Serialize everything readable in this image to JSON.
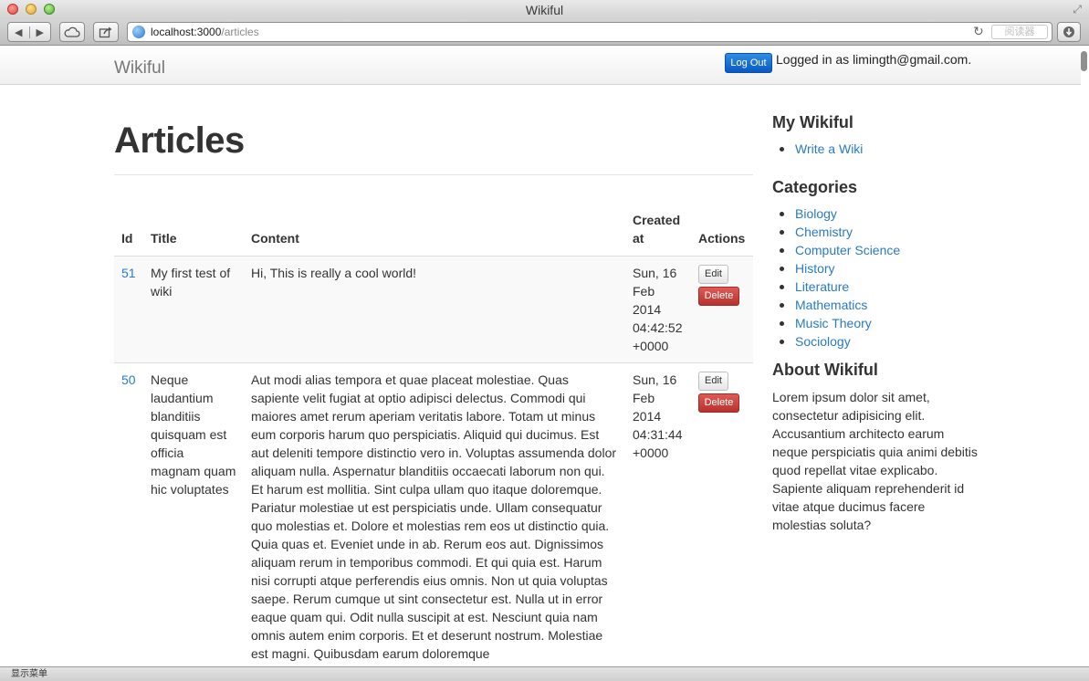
{
  "window": {
    "title": "Wikiful"
  },
  "toolbar": {
    "url_host": "localhost:3000",
    "url_path": "/articles",
    "reader_label": "阅读器"
  },
  "status_bar": {
    "text": "显示菜单"
  },
  "navbar": {
    "brand": "Wikiful",
    "logout_label": "Log Out",
    "login_text": "Logged in as limingth@gmail.com."
  },
  "main": {
    "title": "Articles",
    "table": {
      "headers": {
        "id": "Id",
        "title": "Title",
        "content": "Content",
        "created_at": "Created at",
        "actions": "Actions"
      },
      "edit_label": "Edit",
      "delete_label": "Delete",
      "rows": [
        {
          "id": "51",
          "title": "My first test of wiki",
          "content": "Hi, This is really a cool world!",
          "created_at": "Sun, 16 Feb 2014 04:42:52 +0000"
        },
        {
          "id": "50",
          "title": "Neque laudantium blanditiis quisquam est officia magnam quam hic voluptates",
          "content": "Aut modi alias tempora et quae placeat molestiae. Quas sapiente velit fugiat at optio adipisci delectus. Commodi qui maiores amet rerum aperiam veritatis labore. Totam ut minus eum corporis harum quo perspiciatis. Aliquid qui ducimus. Est aut deleniti tempore distinctio vero in. Voluptas assumenda dolor aliquam nulla. Aspernatur blanditiis occaecati laborum non qui. Et harum est mollitia. Sint culpa ullam quo itaque doloremque. Pariatur molestiae ut est perspiciatis unde. Ullam consequatur quo molestias et. Dolore et molestias rem eos ut distinctio quia. Quia quas et. Eveniet unde in ab. Rerum eos aut. Dignissimos aliquam rerum in temporibus commodi. Et qui quia est. Harum nisi corrupti atque perferendis eius omnis. Non ut quia voluptas saepe. Rerum cumque ut sint consectetur est. Nulla ut in error eaque quam qui. Odit nulla suscipit at est. Nesciunt quia nam omnis autem enim corporis. Et et deserunt nostrum. Molestiae est magni. Quibusdam earum doloremque",
          "created_at": "Sun, 16 Feb 2014 04:31:44 +0000"
        }
      ]
    }
  },
  "sidebar": {
    "my_wikiful_title": "My Wikiful",
    "my_wikiful_items": [
      "Write a Wiki"
    ],
    "categories_title": "Categories",
    "categories": [
      "Biology",
      "Chemistry",
      "Computer Science",
      "History",
      "Literature",
      "Mathematics",
      "Music Theory",
      "Sociology"
    ],
    "about_title": "About Wikiful",
    "about_text": "Lorem ipsum dolor sit amet, consectetur adipisicing elit. Accusantium architecto earum neque perspiciatis quia animi debitis quod repellat vitae explicabo. Sapiente aliquam reprehenderit id vitae atque ducimus facere molestias soluta?"
  },
  "colors": {
    "link": "#2a7ac6",
    "danger": "#c0403b",
    "primary": "#0a57c2"
  },
  "icons": [
    "close-icon",
    "minimize-icon",
    "zoom-icon",
    "back-icon",
    "forward-icon",
    "cloud-icon",
    "share-icon",
    "globe-icon",
    "reload-icon",
    "download-icon",
    "fullscreen-icon"
  ]
}
